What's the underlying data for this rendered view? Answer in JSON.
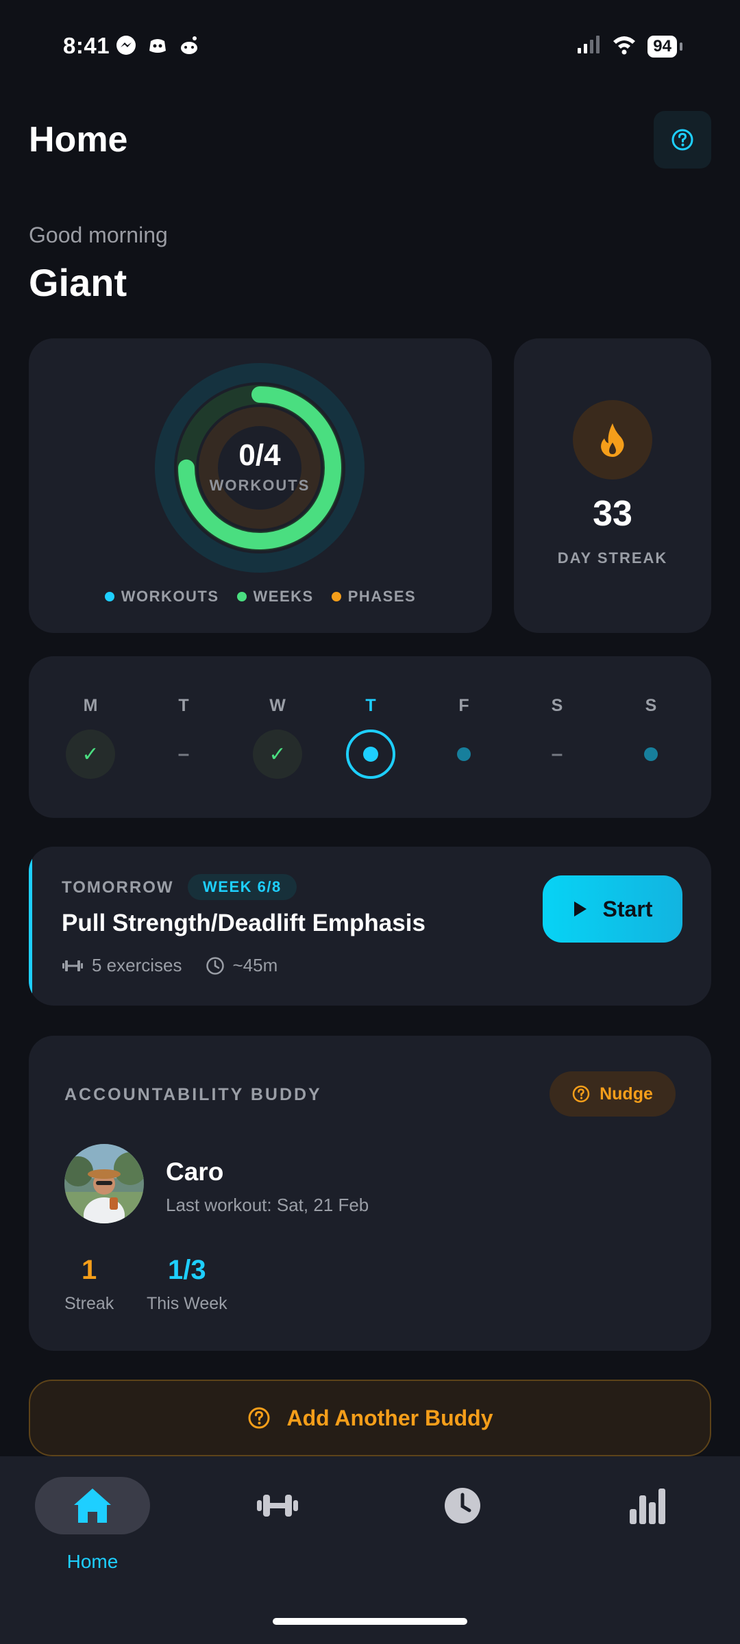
{
  "status_bar": {
    "time": "8:41",
    "battery": "94"
  },
  "header": {
    "title": "Home"
  },
  "greeting": {
    "text": "Good morning",
    "name": "Giant"
  },
  "rings": {
    "value": "0/4",
    "label": "WORKOUTS",
    "progress": {
      "workouts": 0.0,
      "weeks": 0.75,
      "phases": 0.0
    },
    "legend": [
      {
        "label": "WORKOUTS",
        "color": "#1ecfff"
      },
      {
        "label": "WEEKS",
        "color": "#4ade80"
      },
      {
        "label": "PHASES",
        "color": "#f59e1a"
      }
    ]
  },
  "streak": {
    "value": "33",
    "label": "DAY STREAK"
  },
  "week": {
    "days": [
      {
        "letter": "M",
        "state": "done"
      },
      {
        "letter": "T",
        "state": "rest"
      },
      {
        "letter": "W",
        "state": "done"
      },
      {
        "letter": "T",
        "state": "today"
      },
      {
        "letter": "F",
        "state": "planned"
      },
      {
        "letter": "S",
        "state": "rest"
      },
      {
        "letter": "S",
        "state": "planned"
      }
    ]
  },
  "tomorrow": {
    "label": "TOMORROW",
    "badge": "WEEK 6/8",
    "workout": "Pull Strength/Deadlift Emphasis",
    "exercises": "5 exercises",
    "duration": "~45m",
    "start_label": "Start"
  },
  "buddy": {
    "title": "ACCOUNTABILITY BUDDY",
    "nudge_label": "Nudge",
    "name": "Caro",
    "last_workout": "Last workout: Sat, 21 Feb",
    "streak_value": "1",
    "streak_label": "Streak",
    "week_value": "1/3",
    "week_label": "This Week"
  },
  "add_buddy_label": "Add Another Buddy",
  "nav": {
    "home_label": "Home"
  },
  "colors": {
    "accent": "#1ecfff",
    "green": "#4ade80",
    "orange": "#f59e1a",
    "background": "#0f1117",
    "card": "#1c1f29"
  }
}
